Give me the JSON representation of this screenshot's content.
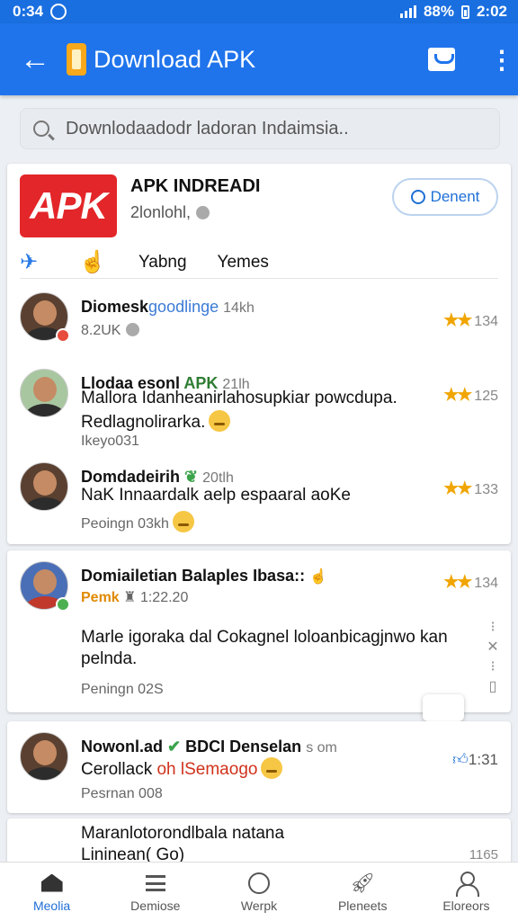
{
  "status_bar": {
    "time": "0:34",
    "battery": "88%",
    "clock": "2:02"
  },
  "app_bar": {
    "title": "Download APK"
  },
  "search": {
    "placeholder": "Downlodaadodr ladoran Indaimsia.."
  },
  "apk_card": {
    "logo_text": "APK",
    "name": "APK INDREADI",
    "subtitle": "2lonlohl,",
    "follow_label": "Denent",
    "tabs": [
      "Yabng",
      "Yemes"
    ]
  },
  "posts": [
    {
      "name": "Diomesk",
      "name_light": "goodlinge",
      "time": "14kh",
      "meta": "8.2UK",
      "stars": "134"
    },
    {
      "name": "Llodaa esonl",
      "name_green": "APK",
      "time": "21lh",
      "line1": "Mallora Idanheanirlahosupkiar powcdupa.",
      "line2": "Redlagnolirarka.",
      "meta": "Ikeyo031",
      "stars": "125"
    },
    {
      "name": "Domdadeirih",
      "time": "20tlh",
      "line1": "NaK Innaardalk aelp espaaral aoKe",
      "meta": "Peoingn 03kh",
      "stars": "133"
    },
    {
      "name": "Domiailetian Balaples Ibasa::",
      "tag": "Pemk",
      "time": "1:22.20",
      "line1": "Marle igoraka dal Cokagnel loloanbicagjnwo kan",
      "line2": "pelnda.",
      "meta": "Peningn 02S",
      "stars": "134"
    },
    {
      "name": "Nowonl.ad",
      "name2": "BDCI Denselan",
      "time": "s om",
      "line1": "Cerollack",
      "line1_red": "oh lSemaogo",
      "meta": "Pesrnan 008",
      "count": "1:31"
    },
    {
      "line1": "Maranlotorondlbala natana",
      "line2": "Lininean( Go)",
      "count": "1165"
    }
  ],
  "bottom_nav": [
    "Meolia",
    "Demiose",
    "Werpk",
    "Pleneets",
    "Eloreors"
  ]
}
